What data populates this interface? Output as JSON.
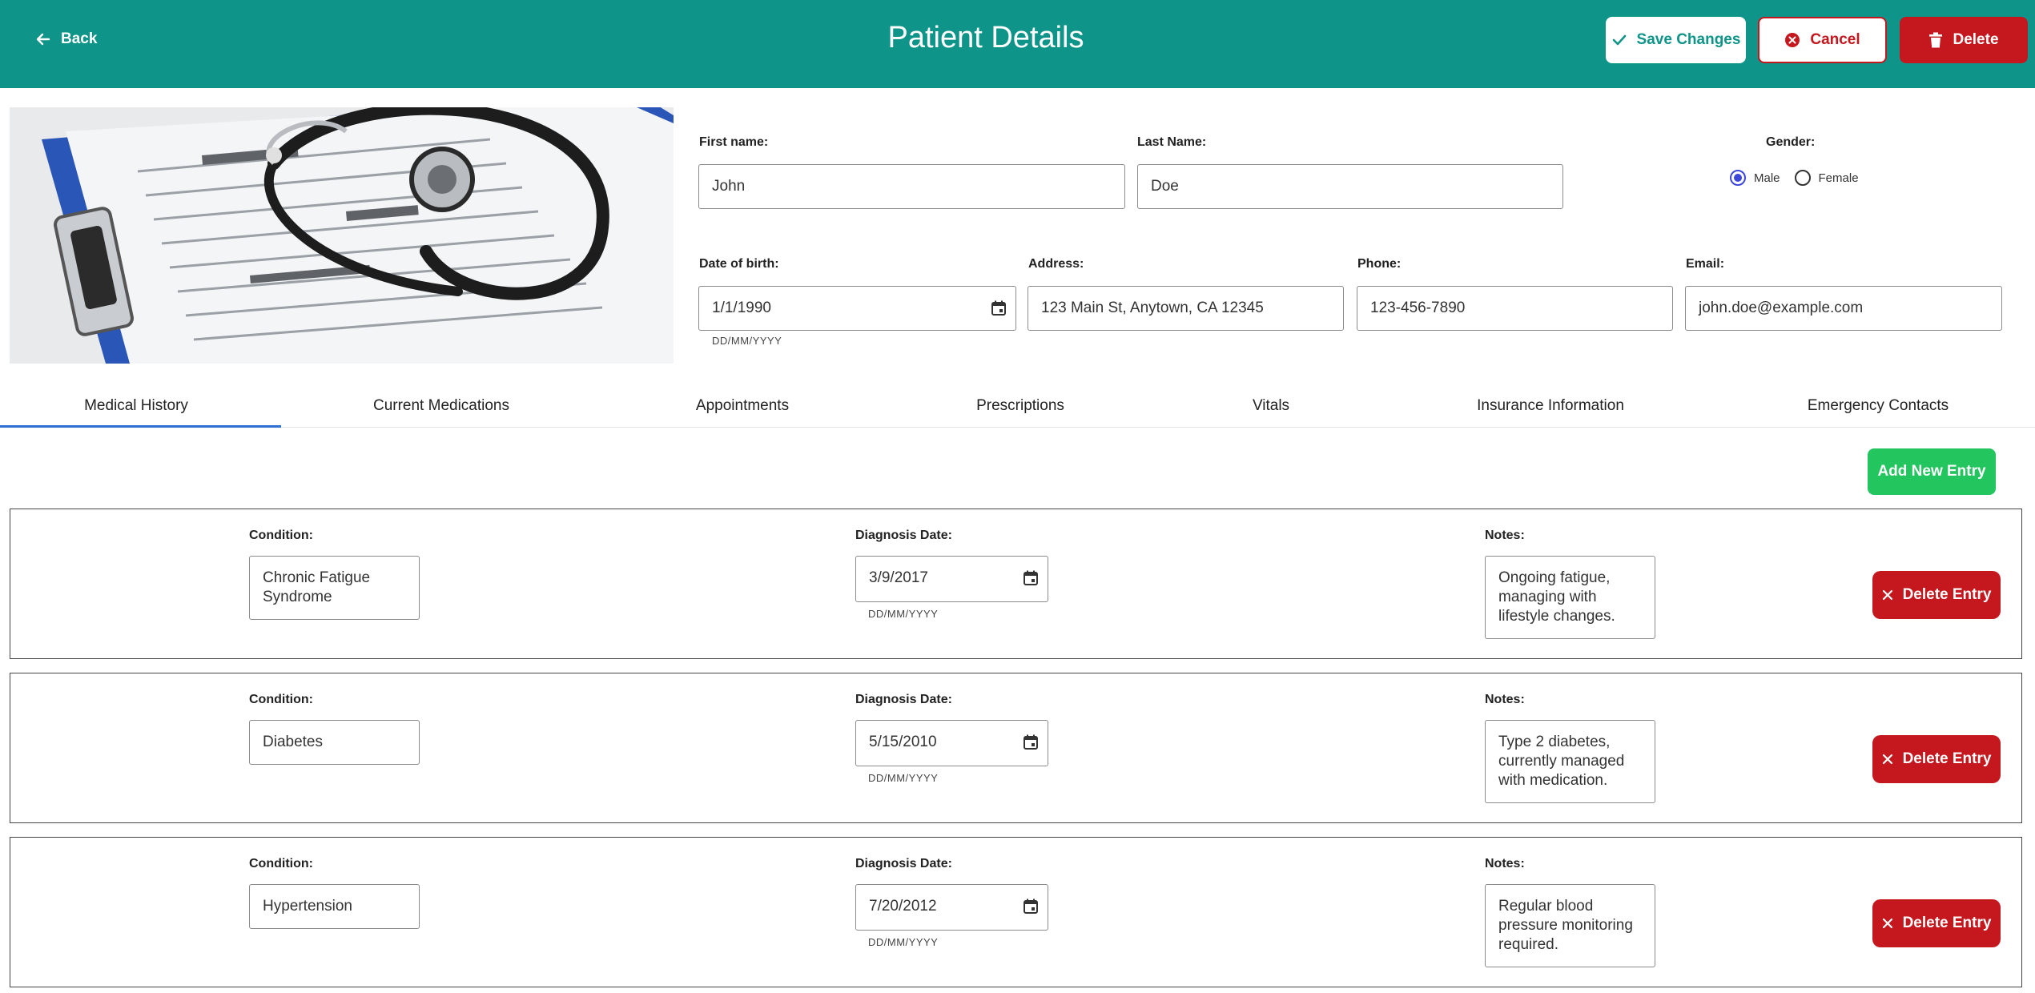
{
  "header": {
    "back_label": "Back",
    "title": "Patient Details",
    "save_label": "Save Changes",
    "cancel_label": "Cancel",
    "delete_label": "Delete",
    "bg_color": "#0e9488"
  },
  "photo": {
    "icon": "clipboard-stethoscope-image"
  },
  "form": {
    "first_name_label": "First name:",
    "first_name": "John",
    "last_name_label": "Last Name:",
    "last_name": "Doe",
    "gender_label": "Gender:",
    "gender_options": [
      "Male",
      "Female"
    ],
    "gender_selected": "Male",
    "dob_label": "Date of birth:",
    "dob": "1/1/1990",
    "dob_hint": "DD/MM/YYYY",
    "address_label": "Address:",
    "address": "123 Main St, Anytown, CA 12345",
    "phone_label": "Phone:",
    "phone": "123-456-7890",
    "email_label": "Email:",
    "email": "john.doe@example.com"
  },
  "tabs": [
    "Medical History",
    "Current Medications",
    "Appointments",
    "Prescriptions",
    "Vitals",
    "Insurance Information",
    "Emergency Contacts"
  ],
  "active_tab": "Medical History",
  "add_entry_label": "Add New Entry",
  "entry_labels": {
    "condition": "Condition:",
    "diagnosis_date": "Diagnosis Date:",
    "notes": "Notes:",
    "date_hint": "DD/MM/YYYY",
    "delete": "Delete Entry"
  },
  "entries": [
    {
      "condition": "Chronic Fatigue Syndrome",
      "diagnosis_date": "3/9/2017",
      "notes": "Ongoing fatigue, managing with lifestyle changes."
    },
    {
      "condition": "Diabetes",
      "diagnosis_date": "5/15/2010",
      "notes": "Type 2 diabetes, currently managed with medication."
    },
    {
      "condition": "Hypertension",
      "diagnosis_date": "7/20/2012",
      "notes": "Regular blood pressure monitoring required."
    }
  ],
  "colors": {
    "accent": "#0e9488",
    "danger": "#c5171e",
    "success": "#22c55e",
    "tab_indicator": "#2d6fd3",
    "radio": "#3c46d9"
  }
}
